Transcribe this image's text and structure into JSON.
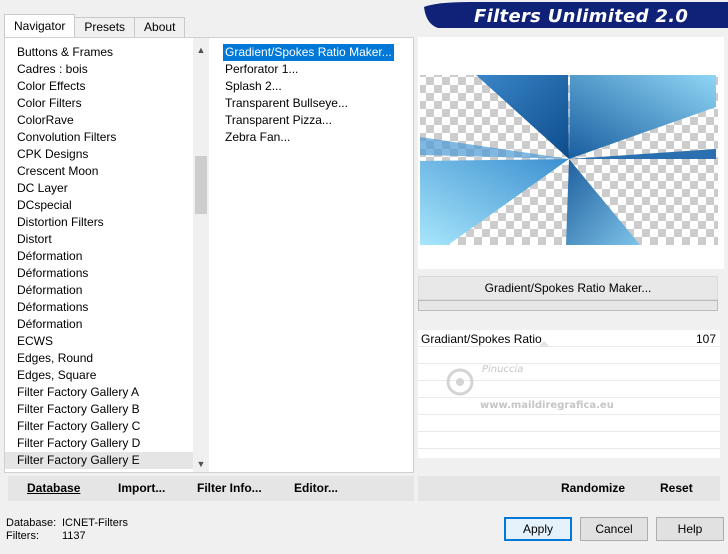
{
  "app": {
    "title": "Filters Unlimited 2.0"
  },
  "tabs": [
    {
      "label": "Navigator",
      "active": true
    },
    {
      "label": "Presets",
      "active": false
    },
    {
      "label": "About",
      "active": false
    }
  ],
  "categories": [
    "Buttons & Frames",
    "Cadres : bois",
    "Color Effects",
    "Color Filters",
    "ColorRave",
    "Convolution Filters",
    "CPK Designs",
    "Crescent Moon",
    "DC Layer",
    "DCspecial",
    "Distortion Filters",
    "Distort",
    "Déformation",
    "Déformations",
    "Déformation",
    "Déformations",
    "Déformation",
    "ECWS",
    "Edges, Round",
    "Edges, Square",
    "Filter Factory Gallery A",
    "Filter Factory Gallery B",
    "Filter Factory Gallery C",
    "Filter Factory Gallery D",
    "Filter Factory Gallery E"
  ],
  "selected_category": "Filter Factory Gallery E",
  "filters": [
    "Gradient/Spokes Ratio Maker...",
    "Perforator 1...",
    "Splash 2...",
    "Transparent Bullseye...",
    "Transparent Pizza...",
    "Zebra Fan..."
  ],
  "selected_filter": "Gradient/Spokes Ratio Maker...",
  "filter_name_button": "Gradient/Spokes Ratio Maker...",
  "params": [
    {
      "name": "Gradiant/Spokes Ratio",
      "value": "107"
    }
  ],
  "watermark": {
    "name": "Pinuccia",
    "url": "www.maildiregrafica.eu"
  },
  "toolbar_left": {
    "database": "Database",
    "import": "Import...",
    "filter_info": "Filter Info...",
    "editor": "Editor..."
  },
  "toolbar_right": {
    "randomize": "Randomize",
    "reset": "Reset"
  },
  "status": {
    "database_label": "Database:",
    "database_value": "ICNET-Filters",
    "filters_label": "Filters:",
    "filters_value": "1137"
  },
  "buttons": {
    "apply": "Apply",
    "cancel": "Cancel",
    "help": "Help"
  },
  "colors": {
    "banner": "#0f2278",
    "selection": "#0078d7"
  }
}
